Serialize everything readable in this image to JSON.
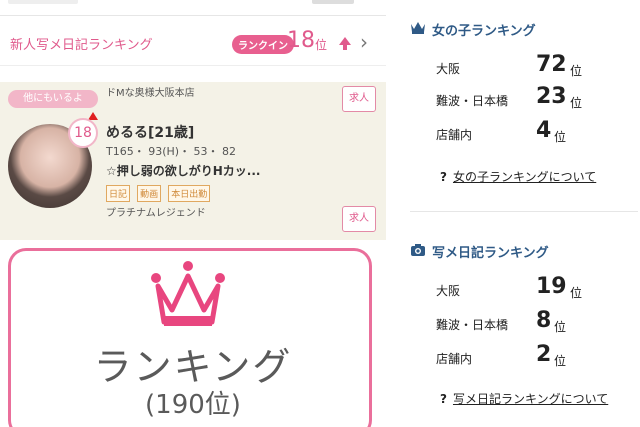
{
  "left": {
    "ranking_row": {
      "label": "新人写メ日記ランキング",
      "rank_in_badge": "ランクイン",
      "rank_number": "18",
      "rank_unit": "位"
    },
    "card": {
      "shop_name": "ドMな奥様大阪本店",
      "others_label": "他にもいるよ",
      "recruit_label": "求人",
      "avatar_rank": "18",
      "name": "めるる[21歳]",
      "stats": "T165・ 93(H)・ 53・ 82",
      "comment": "☆押し弱の欲しがりHカッ...",
      "tags": [
        "日記",
        "動画",
        "本日出勤"
      ],
      "rank_title": "プラチナムレジェンド"
    },
    "banner": {
      "title": "ランキング",
      "subtitle": "(190位)"
    }
  },
  "right": {
    "girl_ranking": {
      "title": "女の子ランキング",
      "rows": [
        {
          "label": "大阪",
          "value": "72",
          "unit": "位"
        },
        {
          "label": "難波・日本橋",
          "value": "23",
          "unit": "位"
        },
        {
          "label": "店舗内",
          "value": "4",
          "unit": "位"
        }
      ],
      "about_q": "?",
      "about_link": "女の子ランキングについて"
    },
    "photo_diary_ranking": {
      "title": "写メ日記ランキング",
      "rows": [
        {
          "label": "大阪",
          "value": "19",
          "unit": "位"
        },
        {
          "label": "難波・日本橋",
          "value": "8",
          "unit": "位"
        },
        {
          "label": "店舗内",
          "value": "2",
          "unit": "位"
        }
      ],
      "about_q": "?",
      "about_link": "写メ日記ランキングについて"
    }
  },
  "colors": {
    "pink": "#e05a8c",
    "navy": "#2f5a86",
    "card_bg": "#f4f2e7"
  },
  "icons": {
    "crown": "crown-icon",
    "camera": "camera-icon",
    "arrow_up": "arrow-up-icon",
    "chevron": "chevron-right-icon"
  }
}
